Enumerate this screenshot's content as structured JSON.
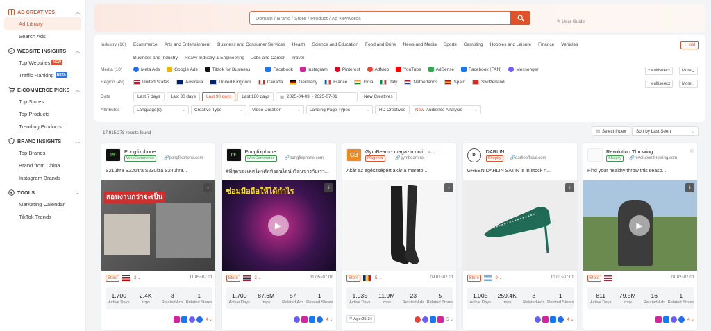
{
  "sidebar": {
    "sections": [
      {
        "title": "AD CREATIVES",
        "items": [
          "Ad Library",
          "Search Ads"
        ]
      },
      {
        "title": "WEBSITE INSIGHTS",
        "items": [
          "Top Websites",
          "Traffic Ranking"
        ]
      },
      {
        "title": "E-COMMERCE PICKS",
        "items": [
          "Top Stores",
          "Top Products",
          "Trending Products"
        ]
      },
      {
        "title": "BRAND INSIGHTS",
        "items": [
          "Top Brands",
          "Brand from China",
          "Instagram Brands"
        ]
      },
      {
        "title": "TOOLS",
        "items": [
          "Marketing Calendar",
          "TikTok Trends"
        ]
      }
    ],
    "badges": {
      "new": "NEW",
      "beta": "BETA"
    }
  },
  "search": {
    "placeholder": "Domain / Brand / Store / Product / Ad Keywords",
    "user_guide": "User Guide"
  },
  "filters": {
    "industry_label": "Industry (16)",
    "industries_row1": [
      "Ecommerce",
      "Arts and Entertainment",
      "Business and Consumer Services",
      "Health",
      "Science and Education",
      "Food and Drink",
      "News and Media",
      "Sports",
      "Gambling",
      "Hobbies and Leisure",
      "Finance",
      "Vehicles"
    ],
    "industries_row2": [
      "Business and Industry",
      "Heavy Industry & Engineering",
      "Jobs and Career",
      "Travel"
    ],
    "hold": "Hold",
    "media_label": "Media (10)",
    "media": [
      "Meta Ads",
      "Google Ads",
      "Tiktok for Business",
      "Facebook",
      "Instagram",
      "Pinterest",
      "AdMob",
      "YouTube",
      "AdSense",
      "Facebook (FAN)",
      "Messenger"
    ],
    "region_label": "Region (49)",
    "regions": [
      "United States",
      "Australia",
      "United Kingdom",
      "Canada",
      "Germany",
      "France",
      "India",
      "Italy",
      "Netherlands",
      "Spain",
      "Switzerland"
    ],
    "multiselect": "Multiselect",
    "more": "More",
    "date_label": "Date",
    "dates": [
      "Last 7 days",
      "Last 30 days",
      "Last 90 days",
      "Last 180 days"
    ],
    "date_range": "2025-04-03 ~ 2025-07-01",
    "new_creatives": "New Creatives",
    "attributes_label": "Attributes",
    "attributes": [
      "Language(s)",
      "Creative Type",
      "Video Duration",
      "Landing Page Types"
    ],
    "hd_creatives": "HD Creatives",
    "new_label": "New",
    "audience_analysis": "Audience Analysis"
  },
  "results": {
    "count": "17,915,278 results found",
    "select_index": "Select Index",
    "sort": "Sort by Last Seen"
  },
  "cards": [
    {
      "name": "Pongfixphone",
      "platform": "WooCommerce",
      "domain": "pongfixphone.com",
      "text": "S21ultra S22ultra S23ultra S24ultra...",
      "store": "Store",
      "count": "2",
      "date": "11.05~07.01",
      "stats": [
        [
          "1,700",
          "Active Days"
        ],
        [
          "2.4K",
          "Imps"
        ],
        [
          "3",
          "Related Ads"
        ],
        [
          "1",
          "Related Stores"
        ]
      ],
      "foot_count": "4",
      "media_text": "สอนงานกว่าจะเป็น",
      "logo": "PF"
    },
    {
      "name": "Pongfixphone",
      "platform": "WooCommerce",
      "domain": "pongfixphone.com",
      "text": "#ที่สุดของเคสโทรศัพท์ออนไลน์ เรียนช่างกับเรา...",
      "store": "Store",
      "count": "3",
      "date": "11.05~07.01",
      "stats": [
        [
          "1,700",
          "Active Days"
        ],
        [
          "87.6M",
          "Imps"
        ],
        [
          "57",
          "Related Ads"
        ],
        [
          "1",
          "Related Stores"
        ]
      ],
      "foot_count": "4",
      "media_text": "ซ่อมมือถือให้ได้กำไร",
      "logo": "PF"
    },
    {
      "name": "GymBeam - magazin onli...",
      "platform": "Magento",
      "domain": "gymbeam.ro",
      "text": "Akár az egészségért akár a marato...",
      "store": "Store",
      "count": "5",
      "date": "09.01~07.01",
      "stats": [
        [
          "1,035",
          "Active Days"
        ],
        [
          "11.9M",
          "Imps"
        ],
        [
          "23",
          "Related Ads"
        ],
        [
          "5",
          "Related Stores"
        ]
      ],
      "foot_count": "5",
      "age": "Age:25-34",
      "logo": "GB",
      "name_count": "4"
    },
    {
      "name": "DARLIN",
      "platform": "Shopify",
      "domain": "darlinofficial.com",
      "text": "GREEN DARLIN SATIN is in stock n...",
      "store": "Store",
      "count": "9",
      "date": "10.01~07.01",
      "stats": [
        [
          "1,005",
          "Active Days"
        ],
        [
          "259.4K",
          "Imps"
        ],
        [
          "8",
          "Related Ads"
        ],
        [
          "1",
          "Related Stores"
        ]
      ],
      "foot_count": "4",
      "logo": "D"
    },
    {
      "name": "Revolution Throwing",
      "platform": "Shopify",
      "domain": "revolutionthrowing.com",
      "text": "Find your healthy throw this seaso...",
      "store": "Store",
      "count": "",
      "date": "01.02~07.01",
      "stats": [
        [
          "811",
          "Active Days"
        ],
        [
          "79.5M",
          "Imps"
        ],
        [
          "16",
          "Related Ads"
        ],
        [
          "1",
          "Related Stores"
        ]
      ],
      "foot_count": "4",
      "logo": ""
    }
  ]
}
